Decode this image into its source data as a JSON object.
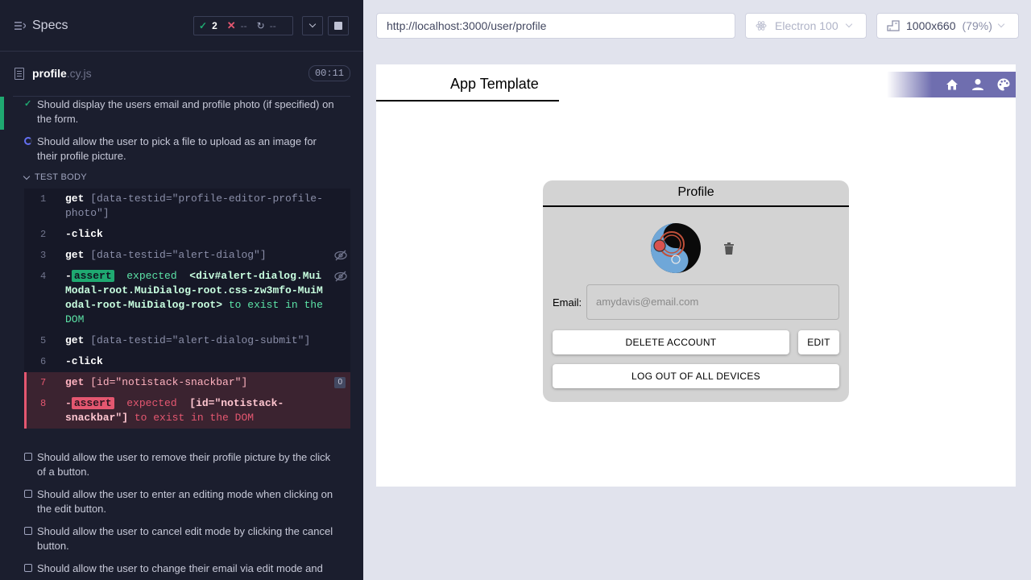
{
  "reporter": {
    "title": "Specs",
    "stats": {
      "passed": "2",
      "failed": "--",
      "pending": "--"
    },
    "spec": {
      "name": "profile",
      "ext": ".cy.js",
      "duration": "00:11"
    },
    "tests": [
      {
        "state": "passed",
        "title": "Should display the users email and profile photo (if specified) on the form."
      },
      {
        "state": "running",
        "title": "Should allow the user to pick a file to upload as an image for their profile picture."
      }
    ],
    "test_body_label": "TEST BODY",
    "commands": [
      {
        "num": "1",
        "name": "get",
        "arg": "[data-testid=\"profile-editor-profile-photo\"]"
      },
      {
        "num": "2",
        "name": "-click"
      },
      {
        "num": "3",
        "name": "get",
        "arg": "[data-testid=\"alert-dialog\"]"
      },
      {
        "num": "4",
        "prefix": "-",
        "badge": "assert",
        "msg_expected": "expected",
        "msg_code": "<div#alert-dialog.MuiModal-root.MuiDialog-root.css-zw3mfo-MuiModal-root-MuiDialog-root>",
        "msg_tail": "to exist in the DOM"
      },
      {
        "num": "5",
        "name": "get",
        "arg": "[data-testid=\"alert-dialog-submit\"]"
      },
      {
        "num": "6",
        "name": "-click"
      },
      {
        "num": "7",
        "name": "get",
        "arg": "[id=\"notistack-snackbar\"]",
        "count": "0"
      },
      {
        "num": "8",
        "prefix": "-",
        "badge": "assert",
        "msg_expected": "expected",
        "msg_code": "[id=\"notistack-snackbar\"]",
        "msg_tail": "to exist in the DOM"
      }
    ],
    "pending_tests": [
      "Should allow the user to remove their profile picture by the click of a button.",
      "Should allow the user to enter an editing mode when clicking on the edit button.",
      "Should allow the user to cancel edit mode by clicking the cancel button.",
      "Should allow the user to change their email via edit mode and"
    ]
  },
  "toolbar": {
    "url": "http://localhost:3000/user/profile",
    "browser": "Electron 100",
    "viewport": "1000x660",
    "zoom": "(79%)"
  },
  "app": {
    "title": "App Template",
    "nav_icons": [
      "home-icon",
      "person-icon",
      "palette-icon"
    ],
    "profile": {
      "heading": "Profile",
      "email_label": "Email:",
      "email_placeholder": "amydavis@email.com",
      "delete_label": "DELETE ACCOUNT",
      "edit_label": "EDIT",
      "logout_label": "LOG OUT OF ALL DEVICES"
    }
  },
  "colors": {
    "reporter_bg": "#1b1e2e",
    "pass": "#1fa971",
    "fail": "#e45770",
    "running": "#6470f3",
    "app_bar": "#6f6eaf",
    "card_bg": "#d3d3d3"
  }
}
